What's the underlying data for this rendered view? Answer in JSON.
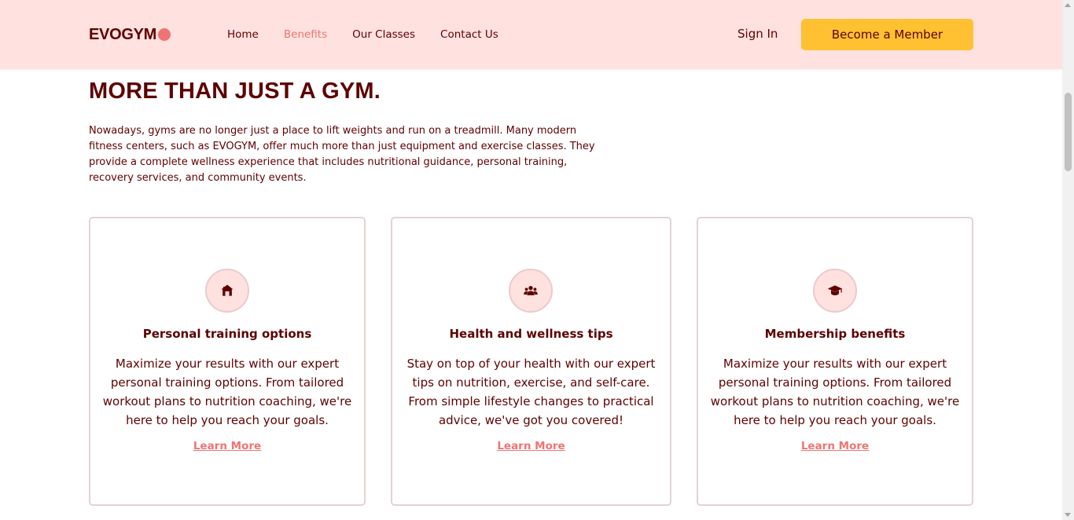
{
  "brand": {
    "name": "EVOGYM"
  },
  "nav": {
    "links": [
      {
        "label": "Home"
      },
      {
        "label": "Benefits"
      },
      {
        "label": "Our Classes"
      },
      {
        "label": "Contact Us"
      }
    ],
    "sign_in": "Sign In",
    "cta": "Become a Member"
  },
  "hero": {
    "heading": "MORE THAN JUST A GYM.",
    "intro": "Nowadays, gyms are no longer just a place to lift weights and run on a treadmill. Many modern fitness centers, such as EVOGYM, offer much more than just equipment and exercise classes. They provide a complete wellness experience that includes nutritional guidance, personal training, recovery services, and community events."
  },
  "cards": [
    {
      "icon": "home-icon",
      "title": "Personal training options",
      "text": "Maximize your results with our expert personal training options. From tailored workout plans to nutrition coaching, we're here to help you reach your goals.",
      "link": "Learn More"
    },
    {
      "icon": "users-icon",
      "title": "Health and wellness tips",
      "text": "Stay on top of your health with our expert tips on nutrition, exercise, and self-care. From simple lifestyle changes to practical advice, we've got you covered!",
      "link": "Learn More"
    },
    {
      "icon": "graduation-cap-icon",
      "title": "Membership benefits",
      "text": "Maximize your results with our expert personal training options. From tailored workout plans to nutrition coaching, we're here to help you reach your goals.",
      "link": "Learn More"
    }
  ],
  "colors": {
    "primary": "#5e0000",
    "accent": "#f07373",
    "nav_bg": "#ffe1df",
    "cta_bg": "#ffc132"
  }
}
